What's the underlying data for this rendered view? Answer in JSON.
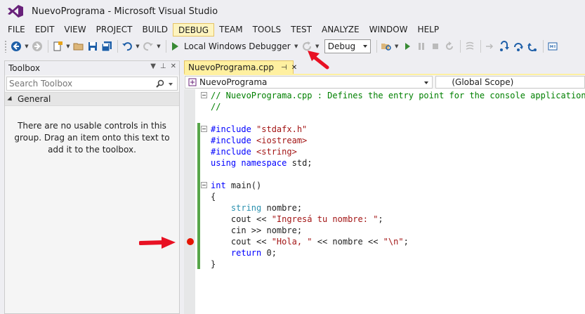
{
  "window": {
    "title": "NuevoPrograma - Microsoft Visual Studio"
  },
  "menu": [
    {
      "label": "FILE",
      "active": false
    },
    {
      "label": "EDIT",
      "active": false
    },
    {
      "label": "VIEW",
      "active": false
    },
    {
      "label": "PROJECT",
      "active": false
    },
    {
      "label": "BUILD",
      "active": false
    },
    {
      "label": "DEBUG",
      "active": true
    },
    {
      "label": "TEAM",
      "active": false
    },
    {
      "label": "TOOLS",
      "active": false
    },
    {
      "label": "TEST",
      "active": false
    },
    {
      "label": "ANALYZE",
      "active": false
    },
    {
      "label": "WINDOW",
      "active": false
    },
    {
      "label": "HELP",
      "active": false
    }
  ],
  "toolbar": {
    "start_debugger_label": "Local Windows Debugger",
    "configuration": "Debug"
  },
  "toolbox": {
    "title": "Toolbox",
    "search_placeholder": "Search Toolbox",
    "group": "General",
    "empty_message": "There are no usable controls in this group. Drag an item onto this text to add it to the toolbox."
  },
  "editor": {
    "tab_label": "NuevoPrograma.cpp",
    "nav_left": "NuevoPrograma",
    "nav_right": "(Global Scope)",
    "code_lines": [
      {
        "text": "// NuevoPrograma.cpp : Defines the entry point for the console application."
      },
      {
        "text": "//"
      },
      {
        "text": ""
      },
      {
        "text": "#include \"stdafx.h\""
      },
      {
        "text": "#include <iostream>"
      },
      {
        "text": "#include <string>"
      },
      {
        "text": "using namespace std;"
      },
      {
        "text": ""
      },
      {
        "text": "int main()"
      },
      {
        "text": "{"
      },
      {
        "text": "    string nombre;"
      },
      {
        "text": "    cout << \"Ingresá tu nombre: \";"
      },
      {
        "text": "    cin >> nombre;"
      },
      {
        "text": "    cout << \"Hola, \" << nombre << \"\\n\";"
      },
      {
        "text": "    return 0;"
      },
      {
        "text": "}"
      }
    ]
  },
  "colors": {
    "breakpoint": "#e51400",
    "arrow": "#e81123",
    "active_tab": "#fff0a0",
    "change_bar": "#57a64a"
  }
}
